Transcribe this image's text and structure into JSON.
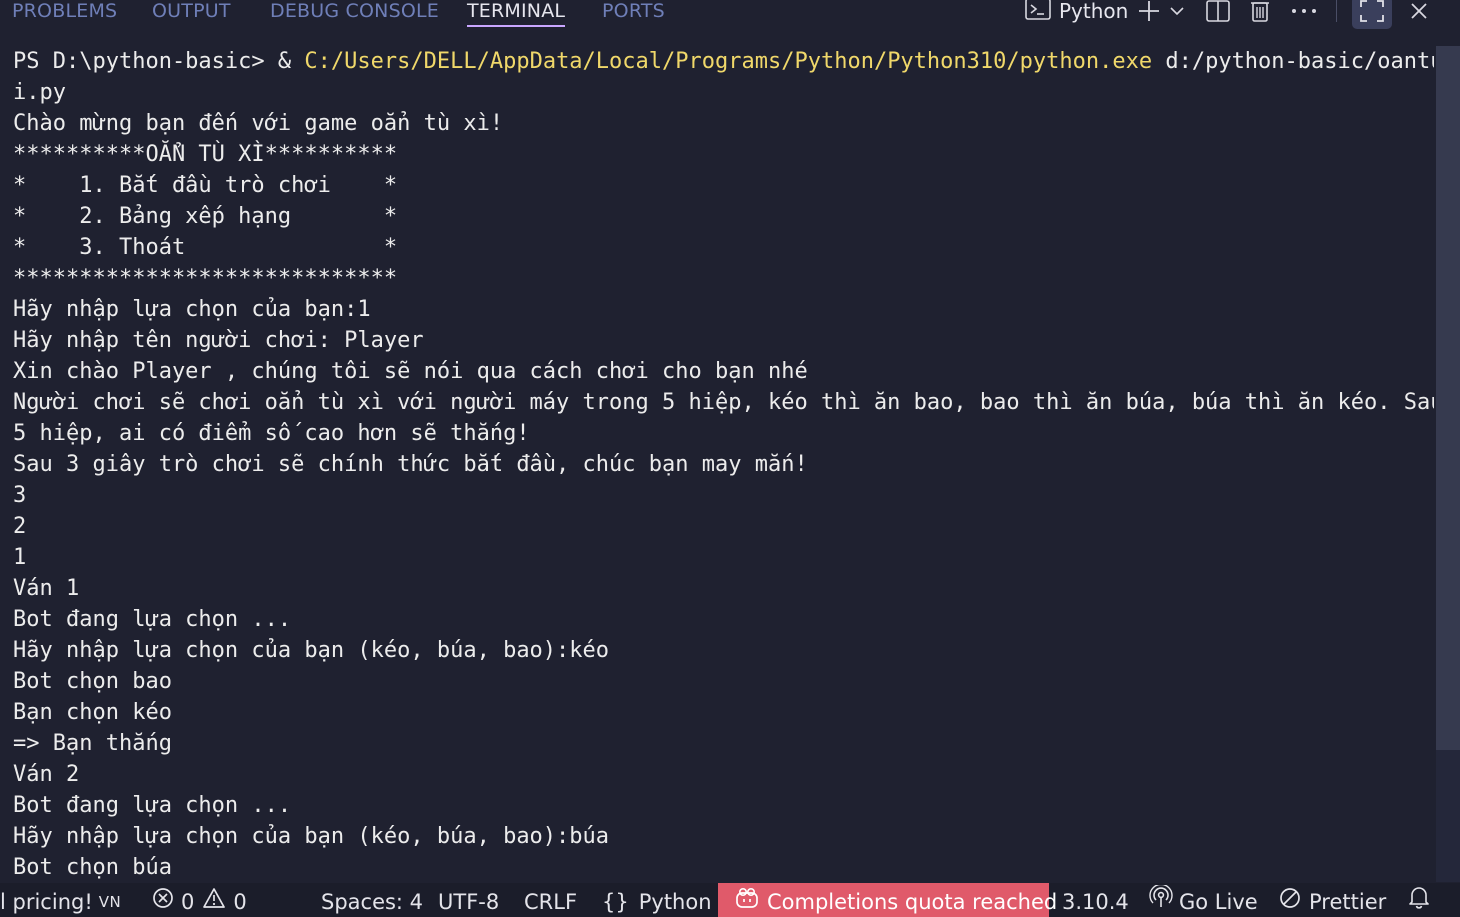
{
  "tabs": [
    {
      "label": "PROBLEMS",
      "active": false
    },
    {
      "label": "OUTPUT",
      "active": false
    },
    {
      "label": "DEBUG CONSOLE",
      "active": false
    },
    {
      "label": "TERMINAL",
      "active": true
    },
    {
      "label": "PORTS",
      "active": false
    }
  ],
  "header": {
    "shell_label": "Python",
    "icons": [
      "terminal-icon",
      "add-icon",
      "chevron-down-icon",
      "split-icon",
      "trash-icon",
      "more-icon",
      "maximize-icon",
      "close-icon"
    ]
  },
  "terminal": {
    "prompt": "PS D:\\python-basic> & ",
    "exe_path": "C:/Users/DELL/AppData/Local/Programs/Python/Python310/python.exe",
    "script_arg": " d:/python-basic/oantux",
    "lines": [
      "i.py",
      "Chào mừng bạn đến với game oẳn tù xì!",
      "**********OẲN TÙ XÌ**********",
      "*    1. Bắt đầu trò chơi    *",
      "*    2. Bảng xếp hạng       *",
      "*    3. Thoát               *",
      "*****************************",
      "Hãy nhập lựa chọn của bạn:1",
      "Hãy nhập tên người chơi: Player",
      "Xin chào Player , chúng tôi sẽ nói qua cách chơi cho bạn nhé",
      "Người chơi sẽ chơi oẳn tù xì với người máy trong 5 hiệp, kéo thì ăn bao, bao thì ăn búa, búa thì ăn kéo. Sau",
      "5 hiệp, ai có điểm số cao hơn sẽ thắng!",
      "Sau 3 giây trò chơi sẽ chính thức bắt đầu, chúc bạn may mắn!",
      "3",
      "2",
      "1",
      "Ván 1",
      "Bot đang lựa chọn ...",
      "Hãy nhập lựa chọn của bạn (kéo, búa, bao):kéo",
      "Bot chọn bao",
      "Bạn chọn kéo",
      "=> Bạn thắng",
      "Ván 2",
      "Bot đang lựa chọn ...",
      "Hãy nhập lựa chọn của bạn (kéo, búa, bao):búa",
      "Bot chọn búa"
    ]
  },
  "statusbar": {
    "pricing_text": "l pricing!",
    "lang_short": "VN",
    "errors": "0",
    "warnings": "0",
    "spaces": "Spaces: 4",
    "encoding": "UTF-8",
    "eol": "CRLF",
    "language": "Python",
    "language_glyph": "{}",
    "completions": "Completions quota reached",
    "python_version": "3.10.4",
    "go_live": "Go Live",
    "prettier": "Prettier",
    "warn_color": "#e05a6a"
  }
}
